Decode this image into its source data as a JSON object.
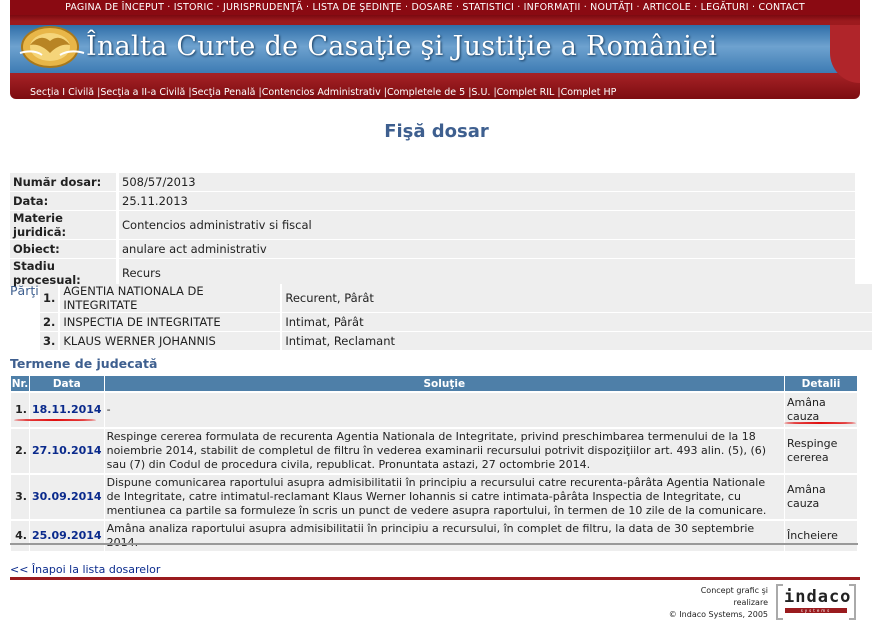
{
  "top_nav": [
    "PAGINA DE ÎNCEPUT",
    "ISTORIC",
    "JURISPRUDENŢĂ",
    "LISTA DE ŞEDINŢE",
    "DOSARE",
    "STATISTICI",
    "INFORMAŢII",
    "NOUTĂŢI",
    "ARTICOLE",
    "LEGĂTURI",
    "CONTACT"
  ],
  "banner": {
    "title": "Înalta Curte de Casaţie şi Justiţie a României"
  },
  "section_nav": [
    "Secţia I Civilă",
    "Secţia a II-a Civilă",
    "Secţia Penală",
    "Contencios Administrativ",
    "Completele de 5",
    "S.U.",
    "Complet RIL",
    "Complet HP"
  ],
  "page_title": "Fişă dosar",
  "info": [
    {
      "key": "Număr dosar:",
      "value": "508/57/2013"
    },
    {
      "key": "Data:",
      "value": "25.11.2013"
    },
    {
      "key": "Materie juridică:",
      "value": "Contencios administrativ si fiscal"
    },
    {
      "key": "Obiect:",
      "value": "anulare act administrativ"
    },
    {
      "key": "Stadiu procesual:",
      "value": "Recurs"
    }
  ],
  "parti_label": "Părţi",
  "parti": [
    {
      "nr": "1.",
      "name": "AGENTIA NATIONALA DE INTEGRITATE",
      "calitate": "Recurent, Pârât"
    },
    {
      "nr": "2.",
      "name": "INSPECTIA DE INTEGRITATE",
      "calitate": "Intimat, Pârât"
    },
    {
      "nr": "3.",
      "name": "KLAUS WERNER JOHANNIS",
      "calitate": "Intimat, Reclamant"
    }
  ],
  "termene_label": "Termene de judecată",
  "termene_headers": {
    "nr": "Nr.",
    "data": "Data",
    "solutie": "Soluţie",
    "detalii": "Detalii"
  },
  "termene": [
    {
      "nr": "1.",
      "data": "18.11.2014",
      "solutie": "-",
      "detalii": "Amâna cauza"
    },
    {
      "nr": "2.",
      "data": "27.10.2014",
      "solutie": "Respinge cererea formulata de recurenta Agentia Nationala de Integritate, privind preschimbarea termenului de la 18 noiembrie 2014, stabilit de completul de filtru în vederea examinarii recursului potrivit dispoziţiilor art. 493 alin. (5), (6) sau (7) din Codul de procedura civila, republicat. Pronuntata astazi, 27 octombrie 2014.",
      "detalii": "Respinge cererea"
    },
    {
      "nr": "3.",
      "data": "30.09.2014",
      "solutie": "Dispune comunicarea raportului asupra admisibilitatii în principiu a recursului catre recurenta-pârâta Agentia Nationale de Integritate, catre intimatul-reclamant Klaus Werner Iohannis si catre intimata-pârâta Inspectia de Integritate, cu mentiunea ca partile sa formuleze în scris un punct de vedere asupra raportului, în termen de 10 zile de la comunicare.",
      "detalii": "Amâna cauza"
    },
    {
      "nr": "4.",
      "data": "25.09.2014",
      "solutie": "Amâna analiza raportului asupra admisibilitatii în principiu a recursului, în complet de filtru, la data de 30 septembrie 2014.",
      "detalii": "Încheiere"
    }
  ],
  "back_link": "<< Înapoi la lista dosarelor",
  "credit": {
    "line1": "Concept grafic şi",
    "line2": "realizare",
    "line3": "© Indaco Systems, 2005"
  },
  "logo": {
    "word": "indaco",
    "sub": "systems"
  },
  "colors": {
    "brand_red": "#8a0a12",
    "header_blue": "#4e7fa8",
    "title_blue": "#3e5f8f",
    "link_blue": "#0a2a8c",
    "annotation_red": "#e01010"
  }
}
